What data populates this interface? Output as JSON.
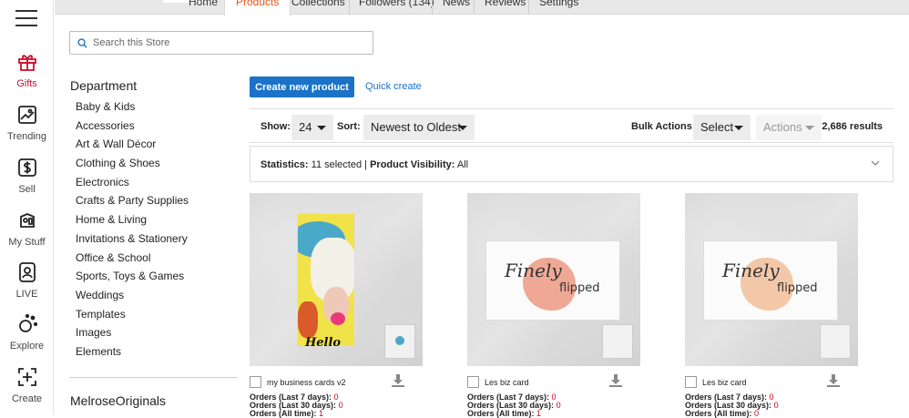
{
  "rail": {
    "items": [
      {
        "label": "Gifts",
        "icon": "gift-icon",
        "active": true
      },
      {
        "label": "Trending",
        "icon": "trending-image-icon"
      },
      {
        "label": "Sell",
        "icon": "dollar-icon"
      },
      {
        "label": "My Stuff",
        "icon": "my-stuff-icon"
      },
      {
        "label": "LIVE",
        "icon": "live-person-icon"
      },
      {
        "label": "Explore",
        "icon": "explore-dots-icon"
      },
      {
        "label": "Create",
        "icon": "create-plus-icon"
      }
    ]
  },
  "tabs": [
    "Home",
    "Products",
    "Collections",
    "Followers (134)",
    "News",
    "Reviews",
    "Settings"
  ],
  "active_tab": "Products",
  "search": {
    "placeholder": "Search this Store"
  },
  "department": {
    "title": "Department",
    "items": [
      "Baby & Kids",
      "Accessories",
      "Art & Wall Décor",
      "Clothing & Shoes",
      "Electronics",
      "Crafts & Party Supplies",
      "Home & Living",
      "Invitations & Stationery",
      "Office & School",
      "Sports, Toys & Games",
      "Weddings",
      "Templates",
      "Images",
      "Elements"
    ]
  },
  "store_name": "MelroseOriginals",
  "actions": {
    "create_label": "Create new product",
    "quick_create_label": "Quick create"
  },
  "controls": {
    "show_label": "Show:",
    "show_value": "24",
    "sort_label": "Sort:",
    "sort_value": "Newest to Oldest",
    "bulk_label": "Bulk Actions:",
    "bulk_value": "Select",
    "actions_value": "Actions",
    "results": "2,686 results"
  },
  "stats": {
    "statistics_label": "Statistics:",
    "selected": "11 selected",
    "visibility_label": "Product Visibility:",
    "visibility_value": "All"
  },
  "products": [
    {
      "name": "my business cards v2",
      "orders7": "0",
      "orders30": "0",
      "ordersAll": "1"
    },
    {
      "name": "Les biz card",
      "orders7": "0",
      "orders30": "0",
      "ordersAll": "1"
    },
    {
      "name": "Les biz card",
      "orders7": "0",
      "orders30": "0",
      "ordersAll": "0"
    }
  ],
  "order_labels": {
    "d7": "Orders (Last 7 days):",
    "d30": "Orders (Last 30 days):",
    "all": "Orders (All time):"
  },
  "card_text": {
    "brand_script": "Finely",
    "brand_sub": "flipped",
    "hello": "Hello"
  },
  "colors": {
    "accent_blue": "#1a73c8",
    "active_tab": "#e5531a",
    "gifts_red": "#c8102e",
    "order_red": "#d0021b"
  }
}
